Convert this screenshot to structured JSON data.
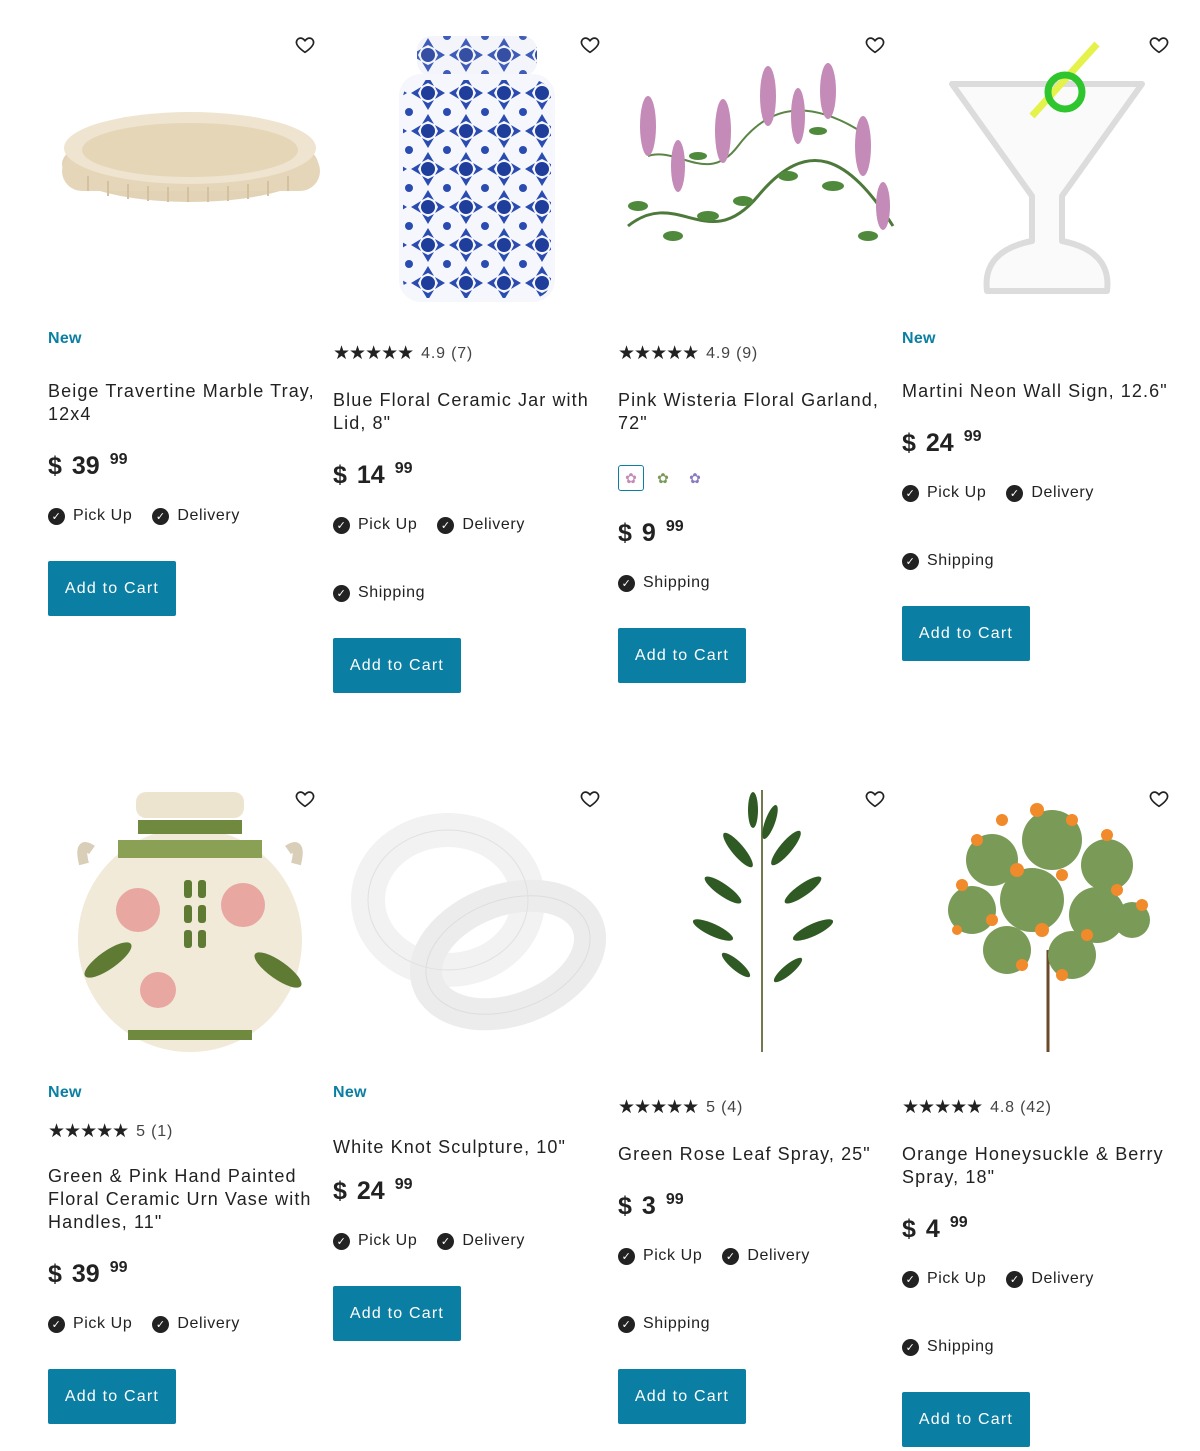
{
  "products": [
    {
      "badge": "New",
      "rating": "",
      "reviews": "",
      "title": "Beige Travertine Marble Tray, 12x4",
      "price_currency": "$",
      "price_dollars": "39",
      "price_cents": "99",
      "options": [
        "Pick Up",
        "Delivery"
      ],
      "button": "Add to Cart",
      "image": "travertine-tray-image"
    },
    {
      "badge": "",
      "rating": "4.9",
      "reviews": "(7)",
      "title": "Blue Floral Ceramic Jar with Lid, 8\"",
      "price_currency": "$",
      "price_dollars": "14",
      "price_cents": "99",
      "options": [
        "Pick Up",
        "Delivery",
        "Shipping"
      ],
      "button": "Add to Cart",
      "image": "blue-floral-jar-image"
    },
    {
      "badge": "",
      "rating": "4.9",
      "reviews": "(9)",
      "title": "Pink Wisteria Floral Garland, 72\"",
      "price_currency": "$",
      "price_dollars": "9",
      "price_cents": "99",
      "options": [
        "Shipping"
      ],
      "button": "Add to Cart",
      "image": "wisteria-garland-image",
      "swatches": [
        "pink",
        "green",
        "purple"
      ]
    },
    {
      "badge": "New",
      "rating": "",
      "reviews": "",
      "title": "Martini Neon Wall Sign, 12.6\"",
      "price_currency": "$",
      "price_dollars": "24",
      "price_cents": "99",
      "options": [
        "Pick Up",
        "Delivery",
        "Shipping"
      ],
      "button": "Add to Cart",
      "image": "martini-neon-sign-image"
    },
    {
      "badge": "New",
      "rating": "5",
      "reviews": "(1)",
      "title": "Green & Pink Hand Painted Floral Ceramic Urn Vase with Handles, 11\"",
      "price_currency": "$",
      "price_dollars": "39",
      "price_cents": "99",
      "options": [
        "Pick Up",
        "Delivery"
      ],
      "button": "Add to Cart",
      "image": "floral-urn-vase-image"
    },
    {
      "badge": "New",
      "rating": "",
      "reviews": "",
      "title": "White Knot Sculpture, 10\"",
      "price_currency": "$",
      "price_dollars": "24",
      "price_cents": "99",
      "options": [
        "Pick Up",
        "Delivery"
      ],
      "button": "Add to Cart",
      "image": "white-knot-sculpture-image"
    },
    {
      "badge": "",
      "rating": "5",
      "reviews": "(4)",
      "title": "Green Rose Leaf Spray, 25\"",
      "price_currency": "$",
      "price_dollars": "3",
      "price_cents": "99",
      "options": [
        "Pick Up",
        "Delivery",
        "Shipping"
      ],
      "button": "Add to Cart",
      "image": "rose-leaf-spray-image"
    },
    {
      "badge": "",
      "rating": "4.8",
      "reviews": "(42)",
      "title": "Orange Honeysuckle & Berry Spray, 18\"",
      "price_currency": "$",
      "price_dollars": "4",
      "price_cents": "99",
      "options": [
        "Pick Up",
        "Delivery",
        "Shipping"
      ],
      "button": "Add to Cart",
      "image": "honeysuckle-spray-image"
    }
  ],
  "theme": {
    "accent": "#0b7fa3",
    "text": "#222222",
    "background": "#ffffff"
  },
  "icons": {
    "wishlist": "heart-outline-icon",
    "check": "check-circle-icon",
    "star": "star-icon"
  }
}
